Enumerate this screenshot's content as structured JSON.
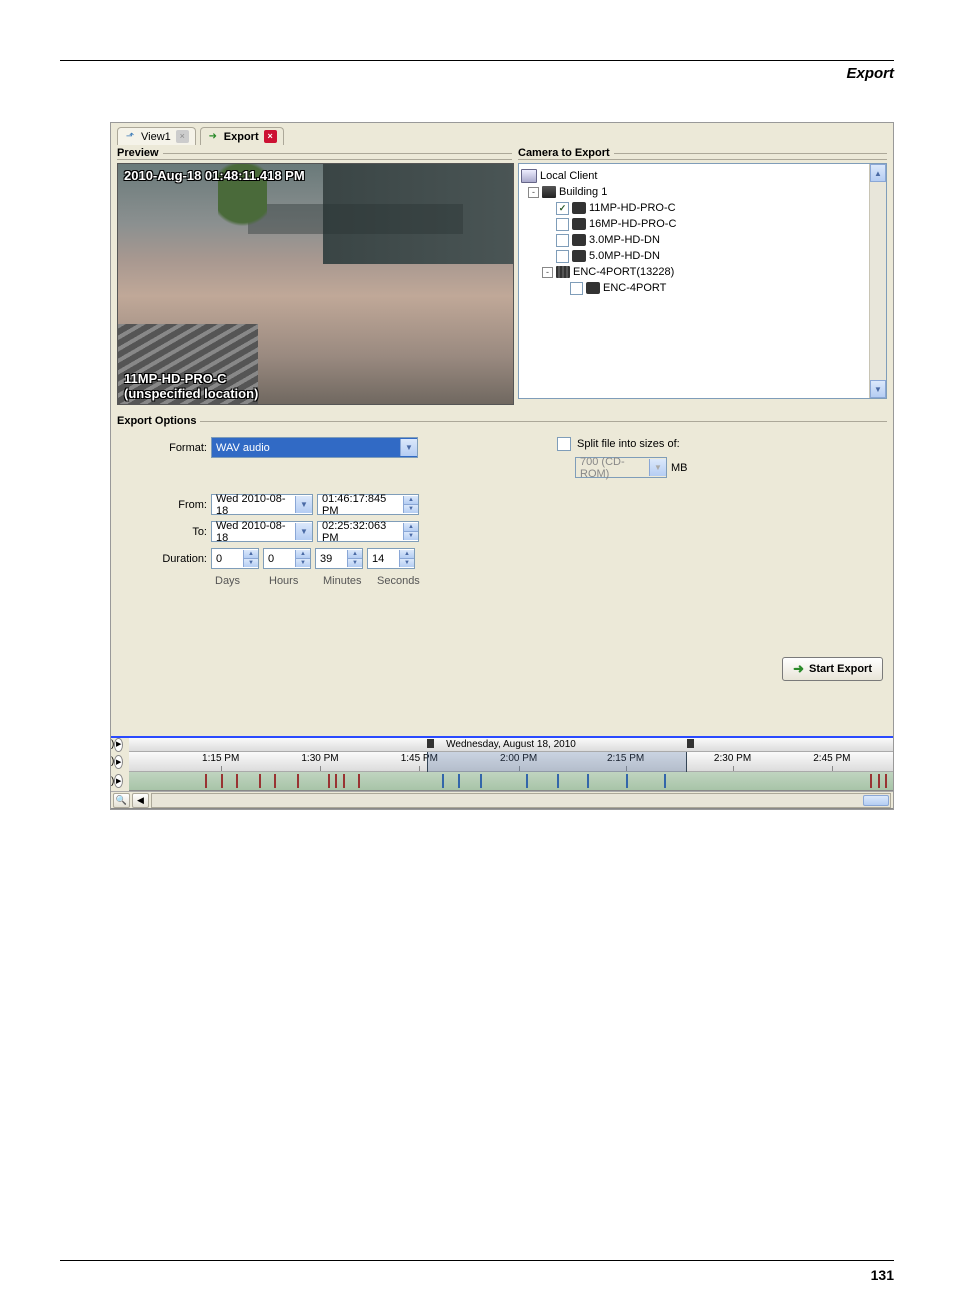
{
  "page": {
    "header": "Export",
    "number": "131"
  },
  "tabs": [
    {
      "label": "View1",
      "icon": "view-icon",
      "closable": false,
      "active": false
    },
    {
      "label": "Export",
      "icon": "export-icon",
      "closable": true,
      "active": true
    }
  ],
  "preview": {
    "title": "Preview",
    "timestamp": "2010-Aug-18 01:48:11.418 PM",
    "camera": "11MP-HD-PRO-C",
    "location": "(unspecified location)"
  },
  "camera_panel": {
    "title": "Camera to Export",
    "root": "Local Client",
    "server": "Building 1",
    "cameras": [
      {
        "name": "11MP-HD-PRO-C",
        "checked": true
      },
      {
        "name": "16MP-HD-PRO-C",
        "checked": false
      },
      {
        "name": "3.0MP-HD-DN",
        "checked": false
      },
      {
        "name": "5.0MP-HD-DN",
        "checked": false
      }
    ],
    "encoder_group": "ENC-4PORT(13228)",
    "encoder": {
      "name": "ENC-4PORT",
      "checked": false
    }
  },
  "options": {
    "title": "Export Options",
    "format_label": "Format:",
    "format_value": "WAV audio",
    "from_label": "From:",
    "from_date": "Wed 2010-08-18",
    "from_time": "01:46:17:845  PM",
    "to_label": "To:",
    "to_date": "Wed 2010-08-18",
    "to_time": "02:25:32:063  PM",
    "duration_label": "Duration:",
    "days": "0",
    "hours": "0",
    "minutes": "39",
    "seconds": "14",
    "d_days": "Days",
    "d_hours": "Hours",
    "d_minutes": "Minutes",
    "d_seconds": "Seconds",
    "split_label": "Split file into sizes of:",
    "split_checked": false,
    "split_value": "700 (CD-ROM)",
    "split_unit": "MB",
    "start_button": "Start Export"
  },
  "timeline": {
    "date": "Wednesday, August 18, 2010",
    "ticks": [
      "1:15 PM",
      "1:30 PM",
      "1:45 PM",
      "2:00 PM",
      "2:15 PM",
      "2:30 PM",
      "2:45 PM"
    ]
  }
}
